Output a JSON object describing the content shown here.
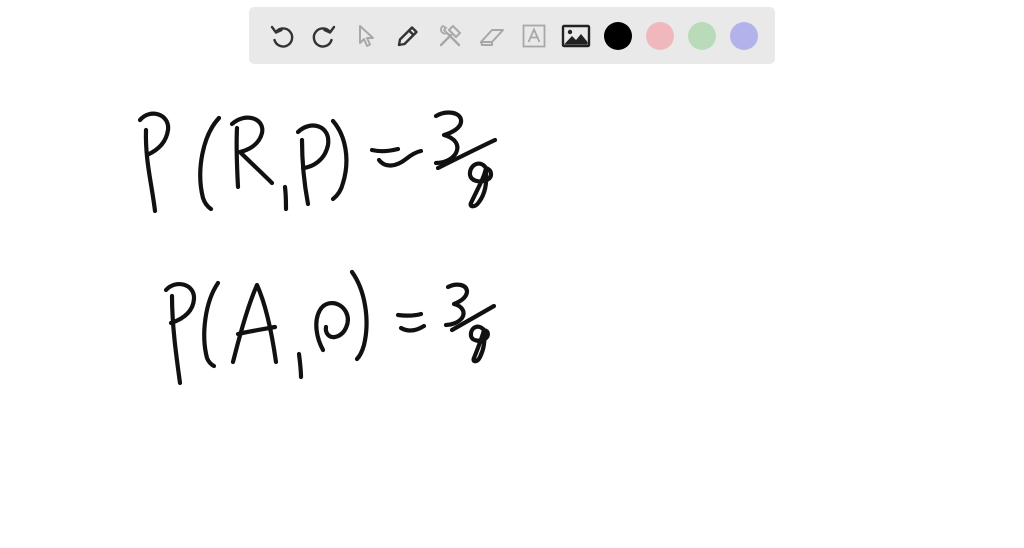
{
  "toolbar": {
    "tools": [
      {
        "name": "undo-icon",
        "interactable": true
      },
      {
        "name": "redo-icon",
        "interactable": true
      },
      {
        "name": "pointer-icon",
        "interactable": true,
        "disabled": true
      },
      {
        "name": "pen-icon",
        "interactable": true
      },
      {
        "name": "tools-icon",
        "interactable": true,
        "disabled": true
      },
      {
        "name": "eraser-icon",
        "interactable": true,
        "disabled": true
      },
      {
        "name": "text-icon",
        "interactable": true,
        "disabled": true
      },
      {
        "name": "image-icon",
        "interactable": true
      }
    ],
    "colors": {
      "black": "#000000",
      "red": "#f0b8bd",
      "green": "#b9dbb9",
      "purple": "#b3b3ec"
    },
    "icon_color": "#333333",
    "disabled_icon_color": "#a8a8a8"
  },
  "canvas": {
    "lines": [
      {
        "text": "P(R,P) = 3/8"
      },
      {
        "text": "P(A,P) = 3/8"
      }
    ]
  }
}
